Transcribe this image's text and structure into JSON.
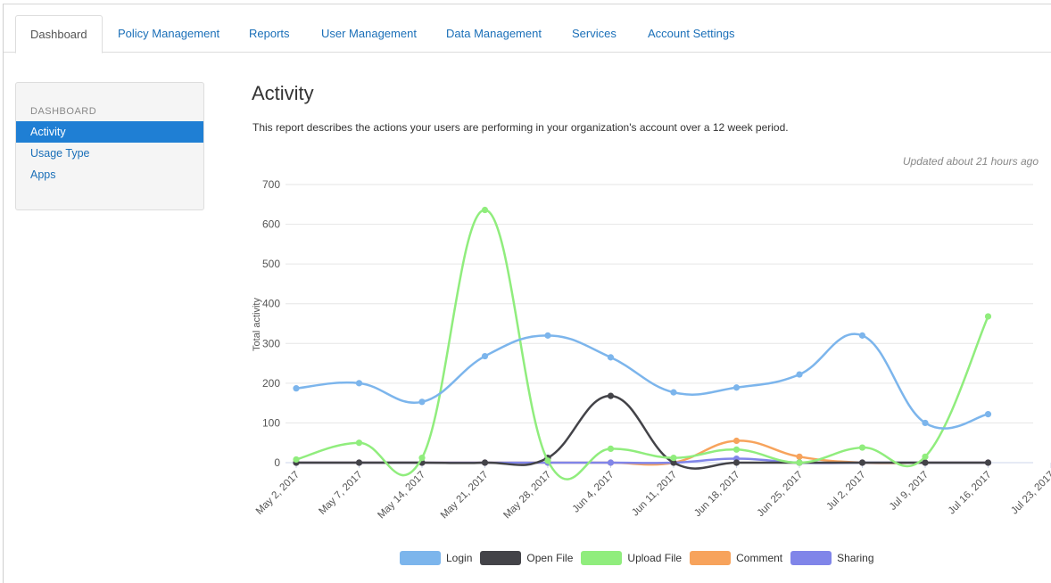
{
  "tabs": [
    {
      "label": "Dashboard",
      "active": true
    },
    {
      "label": "Policy Management"
    },
    {
      "label": "Reports"
    },
    {
      "label": "User Management"
    },
    {
      "label": "Data Management"
    },
    {
      "label": "Services"
    },
    {
      "label": "Account Settings"
    }
  ],
  "sidebar": {
    "header": "DASHBOARD",
    "items": [
      {
        "label": "Activity",
        "active": true
      },
      {
        "label": "Usage Type"
      },
      {
        "label": "Apps"
      }
    ]
  },
  "page": {
    "title": "Activity",
    "description": "This report describes the actions your users are performing in your organization's account over a 12 week period.",
    "updated": "Updated about 21 hours ago"
  },
  "chart_data": {
    "type": "line",
    "ylabel": "Total activity",
    "ylim": [
      0,
      700
    ],
    "yticks": [
      0,
      100,
      200,
      300,
      400,
      500,
      600,
      700
    ],
    "categories": [
      "May 2, 2017",
      "May 7, 2017",
      "May 14, 2017",
      "May 21, 2017",
      "May 28, 2017",
      "Jun 4, 2017",
      "Jun 11, 2017",
      "Jun 18, 2017",
      "Jun 25, 2017",
      "Jul 2, 2017",
      "Jul 9, 2017",
      "Jul 16, 2017",
      "Jul 23, 2017"
    ],
    "series": [
      {
        "name": "Login",
        "color": "#7cb5ec",
        "values": [
          187,
          200,
          153,
          268,
          320,
          265,
          177,
          189,
          222,
          320,
          100,
          122
        ]
      },
      {
        "name": "Open File",
        "color": "#434348",
        "values": [
          0,
          0,
          0,
          0,
          12,
          168,
          0,
          0,
          0,
          0,
          0,
          0
        ]
      },
      {
        "name": "Upload File",
        "color": "#90ed7d",
        "values": [
          8,
          50,
          12,
          636,
          5,
          35,
          12,
          33,
          0,
          38,
          15,
          368
        ]
      },
      {
        "name": "Comment",
        "color": "#f7a35c",
        "values": [
          0,
          0,
          0,
          0,
          0,
          0,
          0,
          55,
          15,
          0,
          0,
          0
        ]
      },
      {
        "name": "Sharing",
        "color": "#8085e9",
        "values": [
          0,
          0,
          0,
          0,
          0,
          0,
          0,
          10,
          0,
          0,
          0,
          0
        ]
      }
    ],
    "grid": true,
    "legend_position": "bottom"
  }
}
